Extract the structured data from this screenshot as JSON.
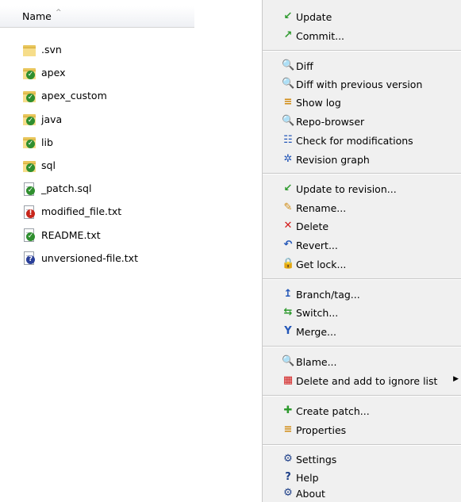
{
  "explorer": {
    "column_header": {
      "label": "Name",
      "sort_indicator": "^"
    },
    "files": [
      {
        "name": ".svn",
        "icon": "plain-folder-icon"
      },
      {
        "name": "apex",
        "icon": "versioned-folder-icon"
      },
      {
        "name": "apex_custom",
        "icon": "versioned-folder-icon"
      },
      {
        "name": "java",
        "icon": "versioned-folder-icon"
      },
      {
        "name": "lib",
        "icon": "versioned-folder-icon"
      },
      {
        "name": "sql",
        "icon": "versioned-folder-icon"
      },
      {
        "name": "_patch.sql",
        "icon": "versioned-file-icon"
      },
      {
        "name": "modified_file.txt",
        "icon": "modified-file-icon"
      },
      {
        "name": "README.txt",
        "icon": "versioned-file-icon"
      },
      {
        "name": "unversioned-file.txt",
        "icon": "unversioned-file-icon"
      }
    ]
  },
  "context_menu": {
    "items": [
      {
        "label": "Update",
        "icon": "update-icon"
      },
      {
        "label": "Commit...",
        "icon": "commit-icon"
      },
      {
        "label": "Diff",
        "icon": "diff-icon"
      },
      {
        "label": "Diff with previous version",
        "icon": "diff-previous-icon"
      },
      {
        "label": "Show log",
        "icon": "show-log-icon"
      },
      {
        "label": "Repo-browser",
        "icon": "repo-browser-icon"
      },
      {
        "label": "Check for modifications",
        "icon": "check-modifications-icon"
      },
      {
        "label": "Revision graph",
        "icon": "revision-graph-icon"
      },
      {
        "label": "Update to revision...",
        "icon": "update-revision-icon"
      },
      {
        "label": "Rename...",
        "icon": "rename-icon"
      },
      {
        "label": "Delete",
        "icon": "delete-icon"
      },
      {
        "label": "Revert...",
        "icon": "revert-icon"
      },
      {
        "label": "Get lock...",
        "icon": "lock-icon"
      },
      {
        "label": "Branch/tag...",
        "icon": "branch-icon"
      },
      {
        "label": "Switch...",
        "icon": "switch-icon"
      },
      {
        "label": "Merge...",
        "icon": "merge-icon"
      },
      {
        "label": "Blame...",
        "icon": "blame-icon"
      },
      {
        "label": "Delete and add to ignore list",
        "icon": "ignore-icon",
        "has_submenu": true
      },
      {
        "label": "Create patch...",
        "icon": "patch-icon"
      },
      {
        "label": "Properties",
        "icon": "properties-icon"
      },
      {
        "label": "Settings",
        "icon": "settings-icon"
      },
      {
        "label": "Help",
        "icon": "help-icon"
      },
      {
        "label": "About",
        "icon": "about-icon"
      }
    ]
  },
  "colors": {
    "menu_background": "#f0f0f0",
    "normal_badge": "#2f8f2f",
    "modified_badge": "#c8261b",
    "unversioned_badge": "#2a3f9a"
  }
}
